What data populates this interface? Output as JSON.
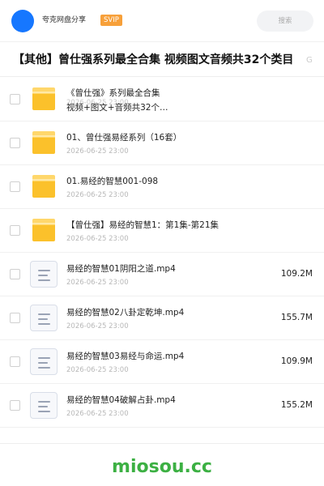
{
  "header": {
    "share_name": "夸克网盘分享",
    "badge": "SVIP",
    "search_placeholder": "搜索"
  },
  "title": {
    "text": "【其他】曾仕强系列最全合集 视频图文音频共32个类目",
    "suffix": "G"
  },
  "files": [
    {
      "type": "folder",
      "name": "《曾仕强》系列最全合集",
      "name_line2": "视频+图文+音频共32个…",
      "date": "2026-06-25 23:00",
      "size": ""
    },
    {
      "type": "folder",
      "name": "01、曾仕强易经系列（16套）",
      "date": "2026-06-25 23:00",
      "size": ""
    },
    {
      "type": "folder",
      "name": "01.易经的智慧001-098",
      "date": "2026-06-25 23:00",
      "size": ""
    },
    {
      "type": "folder",
      "name": "【曾仕强】易经的智慧1：第1集-第21集",
      "date": "2026-06-25 23:00",
      "size": ""
    },
    {
      "type": "file",
      "name": "易经的智慧01阴阳之道.mp4",
      "date": "2026-06-25 23:00",
      "size": "109.2M"
    },
    {
      "type": "file",
      "name": "易经的智慧02八卦定乾坤.mp4",
      "date": "2026-06-25 23:00",
      "size": "155.7M"
    },
    {
      "type": "file",
      "name": "易经的智慧03易经与命运.mp4",
      "date": "2026-06-25 23:00",
      "size": "109.9M"
    },
    {
      "type": "file",
      "name": "易经的智慧04破解占卦.mp4",
      "date": "2026-06-25 23:00",
      "size": "155.2M"
    }
  ],
  "watermark": "miosou.cc",
  "colors": {
    "avatar": "#1677ff",
    "badge": "#f7a03a",
    "folder": "#fbc12b",
    "watermark": "#3cb043"
  }
}
